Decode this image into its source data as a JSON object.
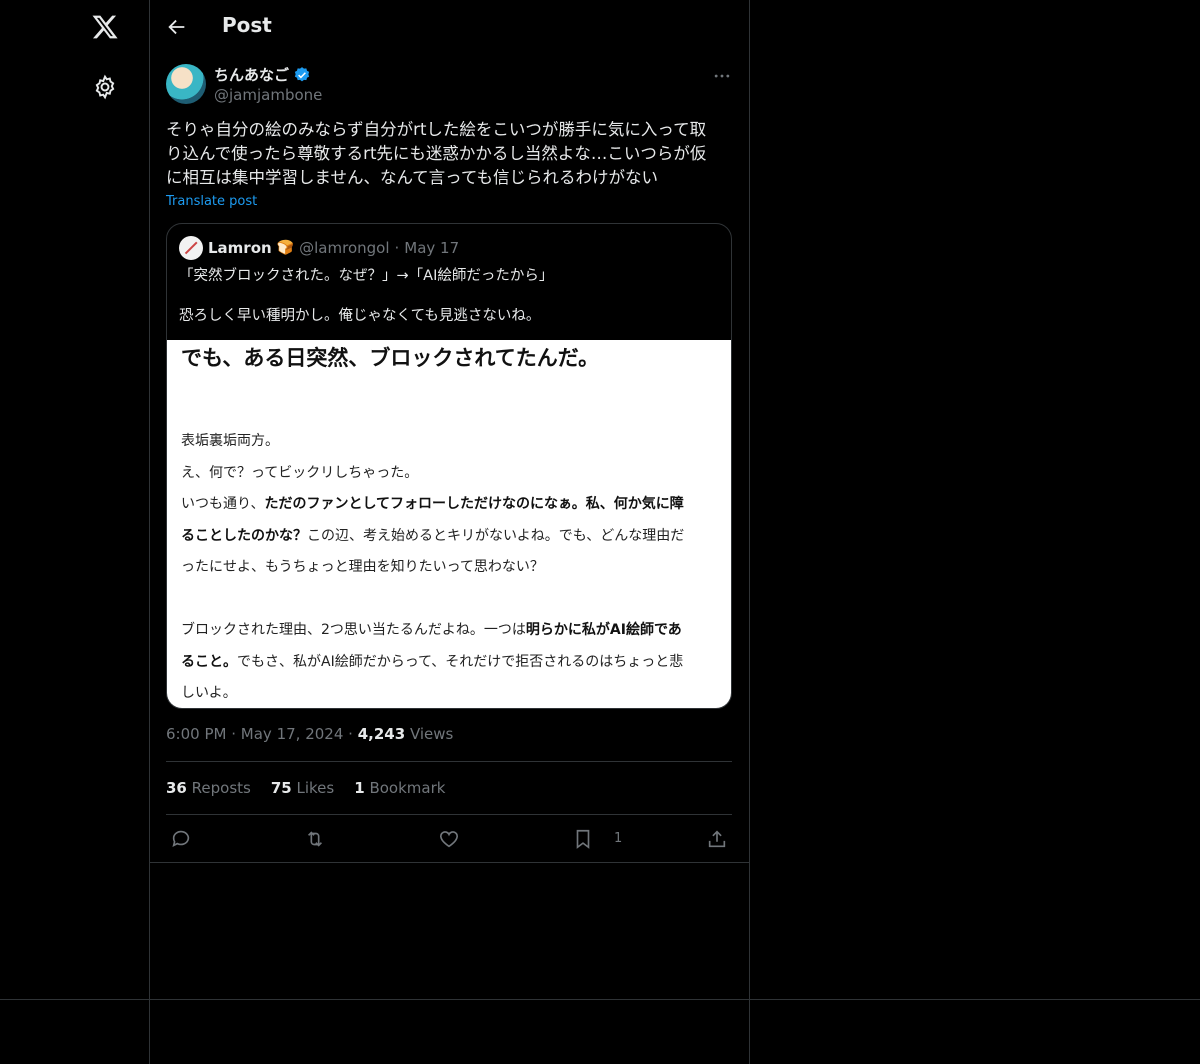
{
  "header": {
    "title": "Post"
  },
  "author": {
    "name": "ちんあなご",
    "handle": "@jamjambone"
  },
  "post": {
    "text_line1": "そりゃ自分の絵のみならず自分がrtした絵をこいつが勝手に気に入って取",
    "text_line2": "り込んで使ったら尊敬するrt先にも迷惑かかるし当然よな…こいつらが仮",
    "text_line3": "に相互は集中学習しません、なんて言っても信じられるわけがない",
    "translate": "Translate post"
  },
  "quote": {
    "name": "Lamron",
    "emoji": "🍞",
    "handle": "@lamrongol",
    "dot": "·",
    "date": "May 17",
    "line1": "「突然ブロックされた。なぜ？」→「AI絵師だったから」",
    "line2": "恐ろしく早い種明かし。俺じゃなくても見逃さないね。",
    "image": {
      "title": "でも、ある日突然、ブロックされてたんだ。",
      "p1": "表垢裏垢両方。",
      "p2": "え、何で？ってビックリしちゃった。",
      "p3a": "いつも通り、",
      "p3b": "ただのファンとしてフォローしただけなのになぁ。私、何か気に障",
      "p3c": "ることしたのかな？",
      "p3d": "この辺、考え始めるとキリがないよね。でも、どんな理由だ",
      "p3e": "ったにせよ、もうちょっと理由を知りたいって思わない？",
      "p4a": "ブロックされた理由、2つ思い当たるんだよね。一つは",
      "p4b": "明らかに私がAI絵師であ",
      "p4c": "ること。",
      "p4d": "でもさ、私がAI絵師だからって、それだけで拒否されるのはちょっと悲",
      "p4e": "しいよ。"
    }
  },
  "meta": {
    "time": "6:00 PM",
    "sep": "·",
    "date": "May 17, 2024",
    "views_count": "4,243",
    "views_label": "Views"
  },
  "stats": {
    "reposts_count": "36",
    "reposts_label": "Reposts",
    "likes_count": "75",
    "likes_label": "Likes",
    "bookmarks_count": "1",
    "bookmarks_label": "Bookmark"
  },
  "actions": {
    "bookmark_count": "1"
  }
}
